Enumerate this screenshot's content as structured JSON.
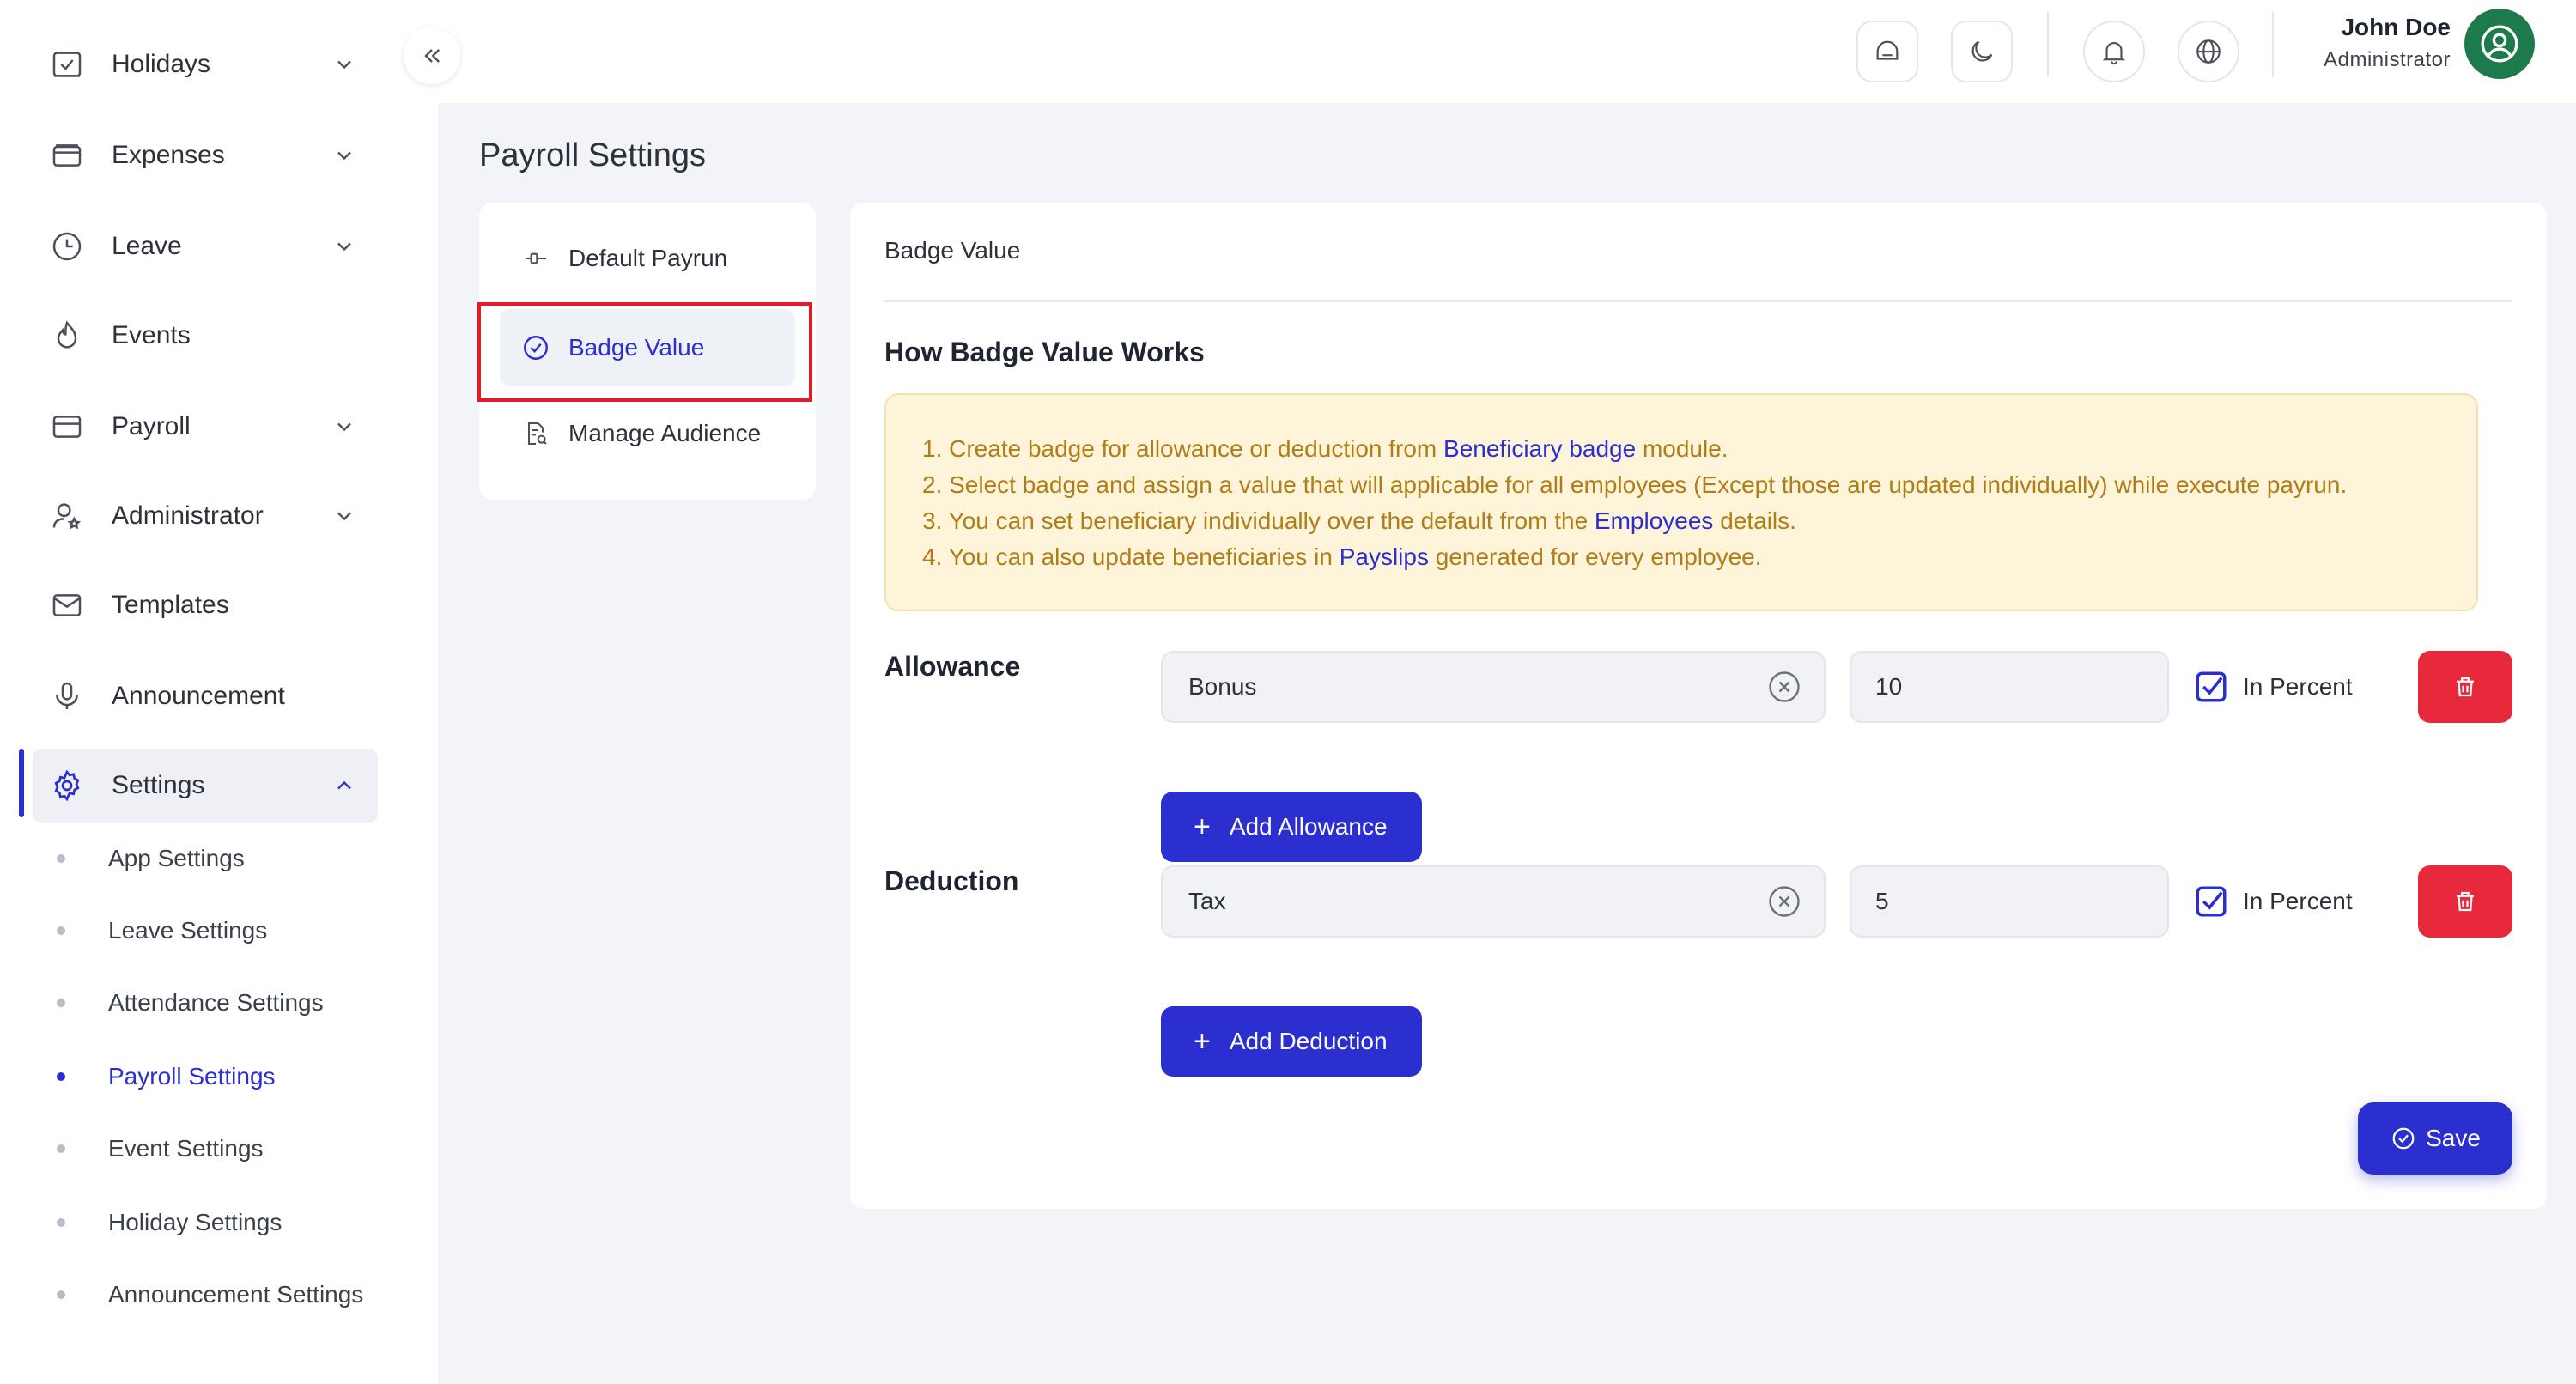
{
  "sidebar": {
    "items": [
      {
        "label": "Holidays",
        "icon": "calendar-check-icon",
        "has_chevron": true
      },
      {
        "label": "Expenses",
        "icon": "wallet-icon",
        "has_chevron": true
      },
      {
        "label": "Leave",
        "icon": "clock-icon",
        "has_chevron": true
      },
      {
        "label": "Events",
        "icon": "flame-icon",
        "has_chevron": false
      },
      {
        "label": "Payroll",
        "icon": "card-icon",
        "has_chevron": true
      },
      {
        "label": "Administrator",
        "icon": "user-star-icon",
        "has_chevron": true
      },
      {
        "label": "Templates",
        "icon": "mail-icon",
        "has_chevron": false
      },
      {
        "label": "Announcement",
        "icon": "microphone-icon",
        "has_chevron": false
      },
      {
        "label": "Settings",
        "icon": "gear-icon",
        "has_chevron": true,
        "expanded": true
      }
    ],
    "settings_sub": [
      {
        "label": "App Settings"
      },
      {
        "label": "Leave Settings"
      },
      {
        "label": "Attendance Settings"
      },
      {
        "label": "Payroll Settings",
        "current": true
      },
      {
        "label": "Event Settings"
      },
      {
        "label": "Holiday Settings"
      },
      {
        "label": "Announcement Settings"
      }
    ]
  },
  "header": {
    "user_name": "John Doe",
    "user_role": "Administrator"
  },
  "page": {
    "title": "Payroll Settings",
    "tabs": [
      {
        "label": "Default Payrun",
        "icon": "payrun-icon"
      },
      {
        "label": "Badge Value",
        "icon": "check-circle-icon",
        "selected": true
      },
      {
        "label": "Manage Audience",
        "icon": "document-search-icon"
      }
    ]
  },
  "card": {
    "header": "Badge Value",
    "how_title": "How Badge Value Works",
    "info": {
      "line1_pre": "1. Create badge for allowance or deduction from ",
      "line1_link": "Beneficiary badge",
      "line1_post": " module.",
      "line2": "2. Select badge and assign a value that will applicable for all employees (Except those are updated individually) while execute payrun.",
      "line3_pre": "3. You can set beneficiary individually over the default from the ",
      "line3_link": "Employees",
      "line3_post": " details.",
      "line4_pre": "4. You can also update beneficiaries in ",
      "line4_link": "Payslips",
      "line4_post": " generated for every employee."
    },
    "allowance": {
      "label": "Allowance",
      "badge": "Bonus",
      "value": "10",
      "percent_label": "In Percent",
      "percent_checked": true,
      "add_label": "Add Allowance"
    },
    "deduction": {
      "label": "Deduction",
      "badge": "Tax",
      "value": "5",
      "percent_label": "In Percent",
      "percent_checked": true,
      "add_label": "Add Deduction"
    },
    "save_label": "Save"
  },
  "colors": {
    "primary": "#2b2fd0",
    "danger": "#e8283b",
    "info_bg": "#fdf4d9",
    "info_text": "#b07d18",
    "avatar": "#1d7a4c"
  }
}
